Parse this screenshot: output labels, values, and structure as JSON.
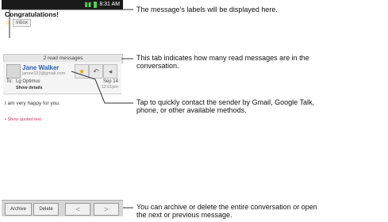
{
  "phone": {
    "status_bar": {
      "clock": "8:31 AM"
    },
    "subject": "Congratulations!",
    "label_chip": "Inbox",
    "read_bar": "2 read messages",
    "sender": {
      "name": "Jane Walker",
      "email": "janew123@gmail.com",
      "to_prefix": "To:",
      "to_name": "Lg Optimus",
      "show_details": "Show details",
      "date": "Sep 14",
      "time": "12:01pm"
    },
    "message_body": "I am very happy for you.",
    "show_quoted": "• Show quoted text",
    "bottom_bar": {
      "archive": "Archive",
      "delete": "Delete",
      "prev": "<",
      "next": ">"
    }
  },
  "callouts": {
    "labels": "The message’s labels will be displayed here.",
    "read_tab_line1": "This tab indicates how many read messages are in the",
    "read_tab_line2": "conversation.",
    "contact_line1": "Tap to quickly contact the sender by Gmail, Google Talk,",
    "contact_line2": "phone, or other available methods.",
    "archive_line1": "You can archive or delete the entire conversation or open",
    "archive_line2": "the next or previous message."
  },
  "icons": {
    "signal": "signal-icon",
    "battery": "battery-icon",
    "star": "star-icon",
    "reply": "reply-icon",
    "more": "more-icon"
  }
}
